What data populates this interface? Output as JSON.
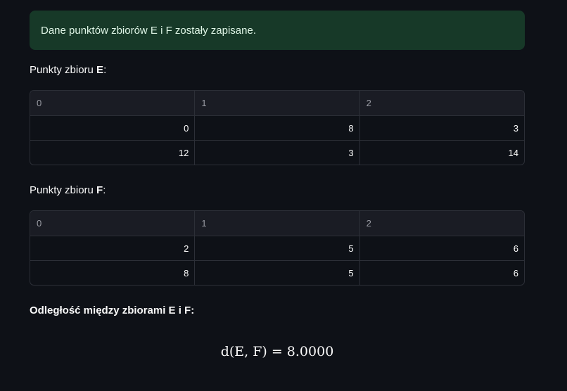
{
  "alert": {
    "message": "Dane punktów zbiorów E i F zostały zapisane."
  },
  "set_e": {
    "heading_prefix": "Punkty zbioru ",
    "heading_letter": "E",
    "heading_suffix": ":",
    "columns": [
      "0",
      "1",
      "2"
    ],
    "rows": [
      [
        "0",
        "8",
        "3"
      ],
      [
        "12",
        "3",
        "14"
      ]
    ]
  },
  "set_f": {
    "heading_prefix": "Punkty zbioru ",
    "heading_letter": "F",
    "heading_suffix": ":",
    "columns": [
      "0",
      "1",
      "2"
    ],
    "rows": [
      [
        "2",
        "5",
        "6"
      ],
      [
        "8",
        "5",
        "6"
      ]
    ]
  },
  "distance": {
    "heading": "Odległość między zbiorami E i F:",
    "formula": "d(E, F) = 8.0000",
    "value": "8.0000"
  }
}
